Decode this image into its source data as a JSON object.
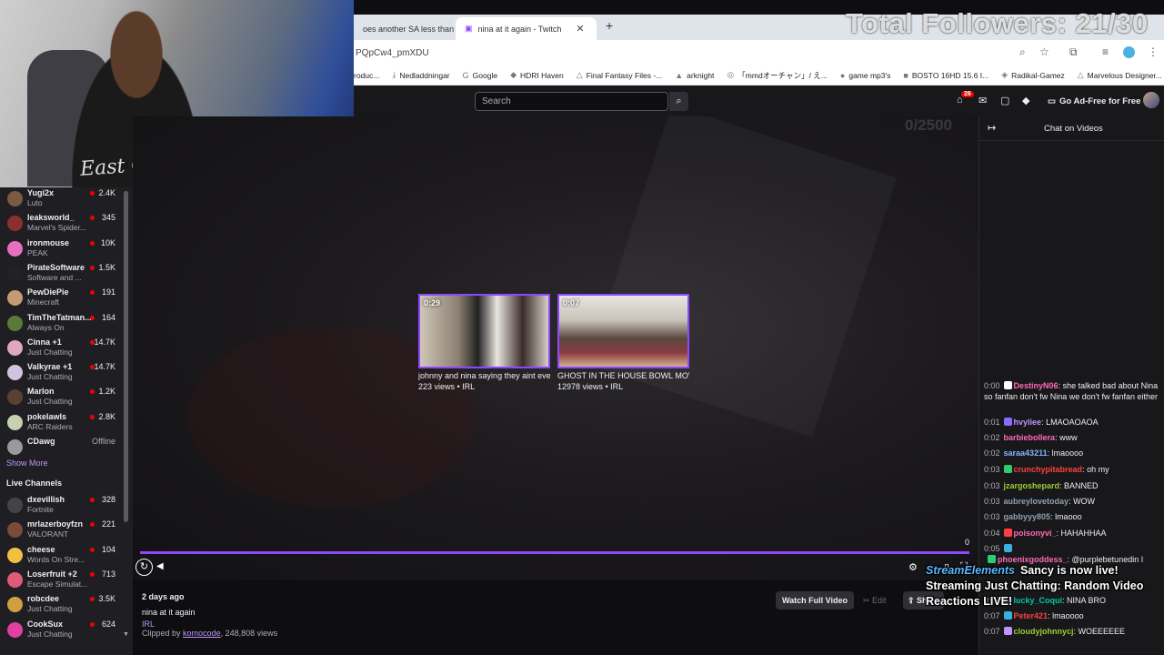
{
  "browser": {
    "tabs": [
      {
        "title": "oes another SA less than",
        "active": false
      },
      {
        "title": "nina at it again - Twitch",
        "active": true
      }
    ],
    "url": "PQpCw4_pmXDU",
    "bookmarks": [
      "roduc...",
      "Nedladdningar",
      "Google",
      "HDRI Haven",
      "Final Fantasy Files -...",
      "arknight",
      "「mmdオーチャン」/ え...",
      "game mp3's",
      "BOSTO 16HD 15.6 I...",
      "Radikal-Gamez",
      "Marvelous Designer..."
    ]
  },
  "overlay": {
    "followers": "Total Followers: 21/30",
    "goal": "0/2500",
    "streamelements_brand": "StreamElements",
    "streamelements_line1": "Sancy is now live!",
    "streamelements_line2": "Streaming Just Chatting: Random Video",
    "streamelements_line3": "Reactions LIVE!"
  },
  "webcam": {
    "shirt_text": "East Coas"
  },
  "nav": {
    "search_placeholder": "Search",
    "notifications": "26",
    "ad_free": "Go Ad-Free for Free"
  },
  "sidebar": {
    "followed": [
      {
        "name": "Yugi2x",
        "game": "Luto",
        "viewers": "2.4K",
        "color": "#7a5a40"
      },
      {
        "name": "leaksworld_",
        "game": "Marvel's Spider...",
        "viewers": "345",
        "color": "#8a3030"
      },
      {
        "name": "ironmouse",
        "game": "PEAK",
        "viewers": "10K",
        "color": "#e66fc0"
      },
      {
        "name": "PirateSoftware",
        "game": "Software and ...",
        "viewers": "1.5K",
        "color": "#222222"
      },
      {
        "name": "PewDiePie",
        "game": "Minecraft",
        "viewers": "191",
        "color": "#c69a74"
      },
      {
        "name": "TimTheTatman...",
        "game": "Always On",
        "viewers": "164",
        "color": "#5a7a3a"
      },
      {
        "name": "Cinna +1",
        "game": "Just Chatting",
        "viewers": "14.7K",
        "color": "#e0a7c0"
      },
      {
        "name": "Valkyrae +1",
        "game": "Just Chatting",
        "viewers": "14.7K",
        "color": "#d0c4e0"
      },
      {
        "name": "Marlon",
        "game": "Just Chatting",
        "viewers": "1.2K",
        "color": "#5a4030"
      },
      {
        "name": "pokelawls",
        "game": "ARC Raiders",
        "viewers": "2.8K",
        "color": "#c7d0b0"
      },
      {
        "name": "CDawg",
        "game": "",
        "viewers": "Offline",
        "color": "#9a9a9a"
      }
    ],
    "show_more": "Show More",
    "live_channels_title": "Live Channels",
    "live": [
      {
        "name": "dxevillish",
        "game": "Fortnite",
        "viewers": "328",
        "color": "#444444"
      },
      {
        "name": "mrlazerboyfzn",
        "game": "VALORANT",
        "viewers": "221",
        "color": "#7a4a3a"
      },
      {
        "name": "cheese",
        "game": "Words On Stre...",
        "viewers": "104",
        "color": "#f0c040"
      },
      {
        "name": "Loserfruit +2",
        "game": "Escape Simulat...",
        "viewers": "713",
        "color": "#e05a7a"
      },
      {
        "name": "robcdee",
        "game": "Just Chatting",
        "viewers": "3.5K",
        "color": "#d0a040"
      },
      {
        "name": "CookSux",
        "game": "Just Chatting",
        "viewers": "624",
        "color": "#e040a0"
      }
    ]
  },
  "player": {
    "recommended": [
      {
        "duration": "0:29",
        "title": "johnny and nina saying they aint eve",
        "meta": "223 views • IRL"
      },
      {
        "duration": "0:07",
        "title": "GHOST IN THE HOUSE BOWL MOV...",
        "meta": "12978 views • IRL"
      }
    ],
    "progress_readout": "0"
  },
  "clip": {
    "ago": "2 days ago",
    "title": "nina at it again",
    "category": "IRL",
    "clipped_by_prefix": "Clipped by",
    "clipper": "komocode",
    "views": ", 248,808 views",
    "watch_full": "Watch Full Video",
    "edit": "Edit",
    "share": "Share"
  },
  "chat": {
    "title": "Chat on Videos",
    "messages": [
      {
        "time": "0:00",
        "user": "DestinyN06",
        "color": "#ff69b4",
        "text": ": she talked bad about Nina so fanfan don't fw Nina we don't fw fanfan either"
      },
      {
        "time": "0:01",
        "user": "hvyliee",
        "color": "#bf94ff",
        "text": ": LMAOAOAOA"
      },
      {
        "time": "0:02",
        "user": "barbiebollera",
        "color": "#ff69b4",
        "text": ": www"
      },
      {
        "time": "0:02",
        "user": "saraa43211",
        "color": "#7fb6ff",
        "text": ": lmaoooo"
      },
      {
        "time": "0:03",
        "user": "crunchypitabread",
        "color": "#ff4040",
        "text": ": oh my"
      },
      {
        "time": "0:03",
        "user": "jzargoshepard",
        "color": "#9acd32",
        "text": ": BANNED"
      },
      {
        "time": "0:03",
        "user": "aubreylovetoday",
        "color": "#8fa0b0",
        "text": ": WOW"
      },
      {
        "time": "0:03",
        "user": "gabbyyy805",
        "color": "#8fa0b0",
        "text": ": lmaooo"
      },
      {
        "time": "0:04",
        "user": "poisonyvi_",
        "color": "#ff69b4",
        "text": ": HAHAHHAA"
      },
      {
        "time": "0:05",
        "user": "",
        "color": "#efeff1",
        "text": ""
      },
      {
        "time": "",
        "user": "phoenixgoddess_",
        "color": "#ff69b4",
        "text": ": @purplebetunedin I"
      },
      {
        "time": "0:07",
        "user": "lucky_Coqui",
        "color": "#00c8a0",
        "text": ": NINA BRO"
      },
      {
        "time": "0:07",
        "user": "Peter421",
        "color": "#ff4040",
        "text": ": lmaoooo"
      },
      {
        "time": "0:07",
        "user": "cloudyjohnnycj",
        "color": "#9acd32",
        "text": ": WOEEEEEE"
      }
    ]
  }
}
